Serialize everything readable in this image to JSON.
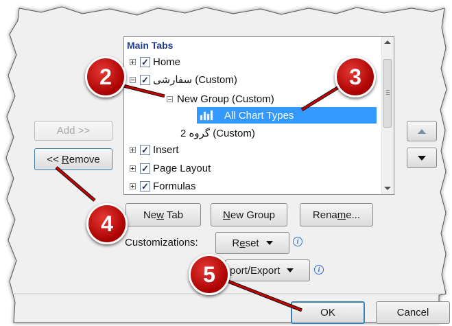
{
  "tree": {
    "header": "Main Tabs",
    "items": [
      {
        "label": "Home",
        "checked": true,
        "expander": "plus"
      },
      {
        "label": "سفارشی (Custom)",
        "checked": true,
        "expander": "minus"
      },
      {
        "label": "New Group (Custom)",
        "expander": "minus"
      },
      {
        "label": "All Chart Types",
        "selected": true,
        "icon": "chart-icon"
      },
      {
        "label": "گروه 2 (Custom)"
      },
      {
        "label": "Insert",
        "checked": true,
        "expander": "plus"
      },
      {
        "label": "Page Layout",
        "checked": true,
        "expander": "plus"
      },
      {
        "label": "Formulas",
        "checked": true,
        "expander": "plus"
      }
    ]
  },
  "buttons": {
    "add": "Add >>",
    "remove_prefix": "<< ",
    "remove_ul": "R",
    "remove_rest": "emove",
    "new_tab_pre": "Ne",
    "new_tab_ul": "w",
    "new_tab_rest": " Tab",
    "new_group_ul": "N",
    "new_group_rest": "ew Group",
    "rename_pre": "Rena",
    "rename_ul": "m",
    "rename_rest": "e...",
    "reset_pre": "R",
    "reset_ul": "e",
    "reset_rest": "set",
    "import_export": "port/Export",
    "ok": "OK",
    "cancel": "Cancel"
  },
  "customizations_label": "Customizations:",
  "badges": [
    "2",
    "3",
    "4",
    "5"
  ],
  "colors": {
    "badge": "#c00000",
    "selection": "#3399ff"
  }
}
